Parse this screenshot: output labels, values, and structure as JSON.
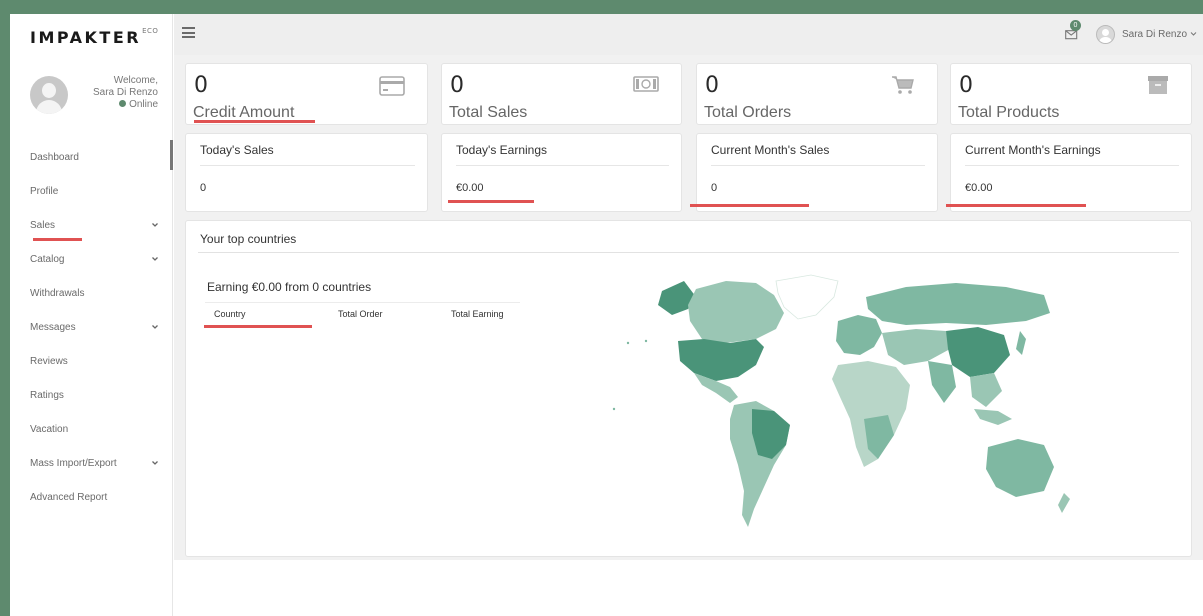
{
  "brand": {
    "name": "IMPAKTER",
    "suffix": "ECO"
  },
  "user": {
    "welcome": "Welcome,",
    "name": "Sara Di Renzo",
    "status": "Online"
  },
  "nav": [
    {
      "label": "Dashboard",
      "has_submenu": false,
      "active": true
    },
    {
      "label": "Profile",
      "has_submenu": false
    },
    {
      "label": "Sales",
      "has_submenu": true
    },
    {
      "label": "Catalog",
      "has_submenu": true
    },
    {
      "label": "Withdrawals",
      "has_submenu": false
    },
    {
      "label": "Messages",
      "has_submenu": true
    },
    {
      "label": "Reviews",
      "has_submenu": false
    },
    {
      "label": "Ratings",
      "has_submenu": false
    },
    {
      "label": "Vacation",
      "has_submenu": false
    },
    {
      "label": "Mass Import/Export",
      "has_submenu": true
    },
    {
      "label": "Advanced Report",
      "has_submenu": false
    }
  ],
  "topbar": {
    "notification_count": "0",
    "user_name": "Sara Di Renzo",
    "icons": [
      "menu-icon",
      "envelope-icon",
      "user-avatar"
    ]
  },
  "stats": [
    {
      "value": "0",
      "label": "Credit Amount",
      "icon": "credit-card-icon"
    },
    {
      "value": "0",
      "label": "Total Sales",
      "icon": "banknote-icon"
    },
    {
      "value": "0",
      "label": "Total Orders",
      "icon": "cart-icon"
    },
    {
      "value": "0",
      "label": "Total Products",
      "icon": "archive-box-icon"
    }
  ],
  "summary": [
    {
      "title": "Today's Sales",
      "value": "0"
    },
    {
      "title": "Today's Earnings",
      "value": "€0.00"
    },
    {
      "title": "Current Month's Sales",
      "value": "0"
    },
    {
      "title": "Current Month's Earnings",
      "value": "€0.00"
    }
  ],
  "countries": {
    "title": "Your top countries",
    "earning_text": "Earning €0.00 from 0 countries",
    "columns": [
      "Country",
      "Total Order",
      "Total Earning"
    ]
  },
  "colors": {
    "accent": "#5e8a6e",
    "highlight": "#e05252",
    "map_light": "#b8d6c8",
    "map_mid": "#7fb8a2",
    "map_dark": "#4a9479"
  }
}
